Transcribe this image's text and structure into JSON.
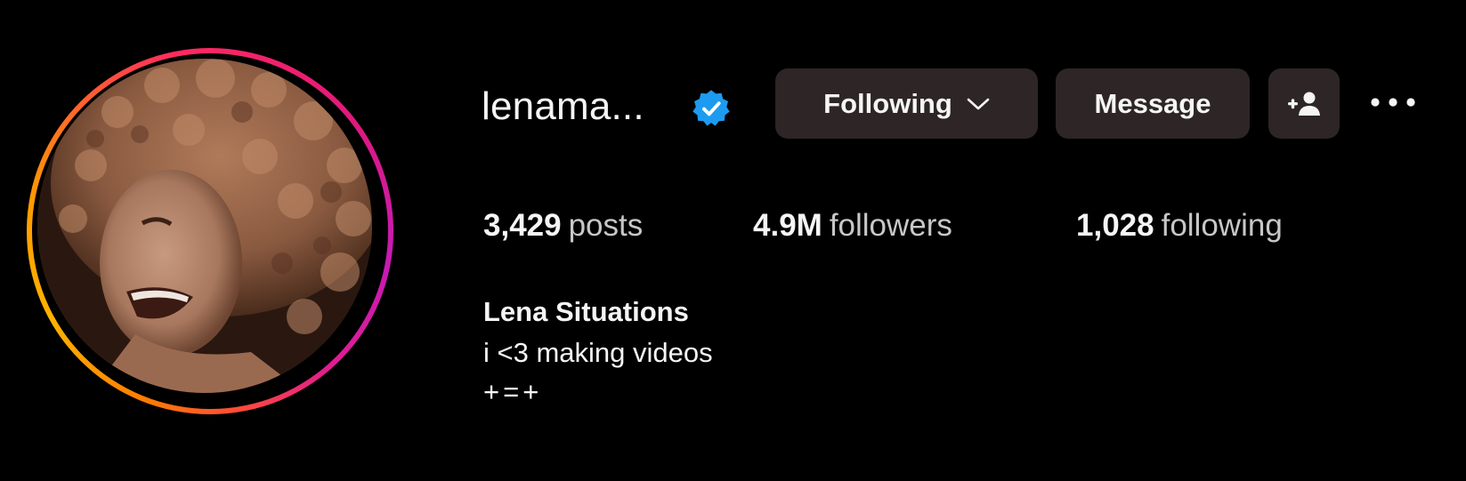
{
  "profile": {
    "username": "lenama...",
    "verified": true,
    "full_name": "Lena Situations",
    "bio": [
      "i <3 making videos",
      "+=+"
    ]
  },
  "actions": {
    "following_label": "Following",
    "message_label": "Message",
    "add_user_icon": "person-add-icon",
    "more_icon": "more-horizontal-icon"
  },
  "stats": {
    "posts_count": "3,429",
    "posts_label": "posts",
    "followers_count": "4.9M",
    "followers_label": "followers",
    "following_count": "1,028",
    "following_label": "following"
  },
  "colors": {
    "background": "#000000",
    "button_bg": "#2d2526",
    "verified_blue": "#1d9bf0",
    "text_primary": "#f5f5f5",
    "text_secondary": "#c7c7c7"
  }
}
